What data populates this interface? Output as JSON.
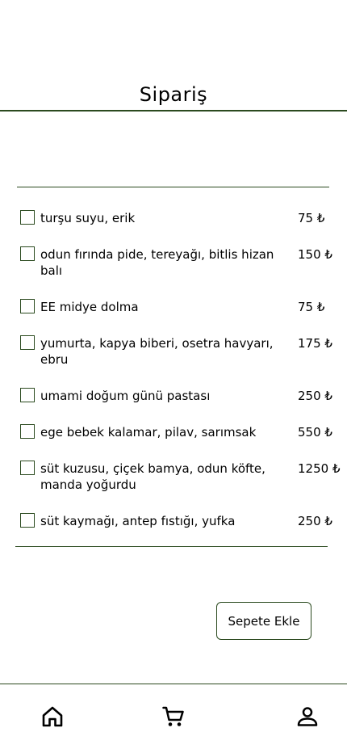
{
  "header": {
    "title": "Sipariş"
  },
  "menu": {
    "items": [
      {
        "name": "turşu suyu, erik",
        "price": "75 ₺",
        "checked": false
      },
      {
        "name": "odun fırında pide, tereyağı, bitlis hizan balı",
        "price": "150 ₺",
        "checked": false
      },
      {
        "name": "EE midye dolma",
        "price": "75 ₺",
        "checked": false
      },
      {
        "name": "yumurta, kapya biberi, osetra havyarı, ebru",
        "price": "175 ₺",
        "checked": false
      },
      {
        "name": "umami doğum günü pastası",
        "price": "250 ₺",
        "checked": false
      },
      {
        "name": "ege bebek kalamar, pilav, sarımsak",
        "price": "550 ₺",
        "checked": false
      },
      {
        "name": "süt kuzusu, çiçek bamya, odun köfte, manda yoğurdu",
        "price": "1250 ₺",
        "checked": false
      },
      {
        "name": "süt kaymağı, antep fıstığı, yufka",
        "price": "250 ₺",
        "checked": false
      }
    ]
  },
  "actions": {
    "add_to_cart_label": "Sepete Ekle"
  },
  "bottom_nav": {
    "items": [
      {
        "icon": "home-icon"
      },
      {
        "icon": "cart-icon"
      },
      {
        "icon": "profile-icon"
      }
    ]
  },
  "colors": {
    "accent": "#2b4a1f",
    "background": "#ffffff",
    "text": "#000000"
  }
}
